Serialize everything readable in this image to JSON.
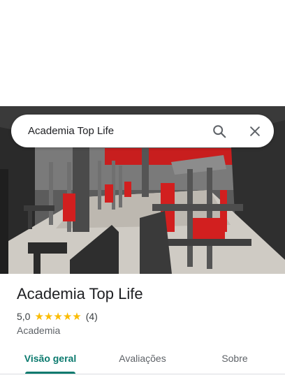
{
  "search": {
    "query": "Academia Top Life"
  },
  "icons": {
    "search": "search-icon",
    "close": "close-icon",
    "star": "star-icon"
  },
  "place": {
    "name": "Academia Top Life",
    "rating": "5,0",
    "stars_filled": 5,
    "review_count": "(4)",
    "category": "Academia"
  },
  "tabs": [
    {
      "label": "Visão geral",
      "active": true
    },
    {
      "label": "Avaliações",
      "active": false
    },
    {
      "label": "Sobre",
      "active": false
    }
  ],
  "colors": {
    "accent": "#0b7a6e",
    "star": "#fbbc04",
    "equipment_red": "#d21f1f"
  }
}
